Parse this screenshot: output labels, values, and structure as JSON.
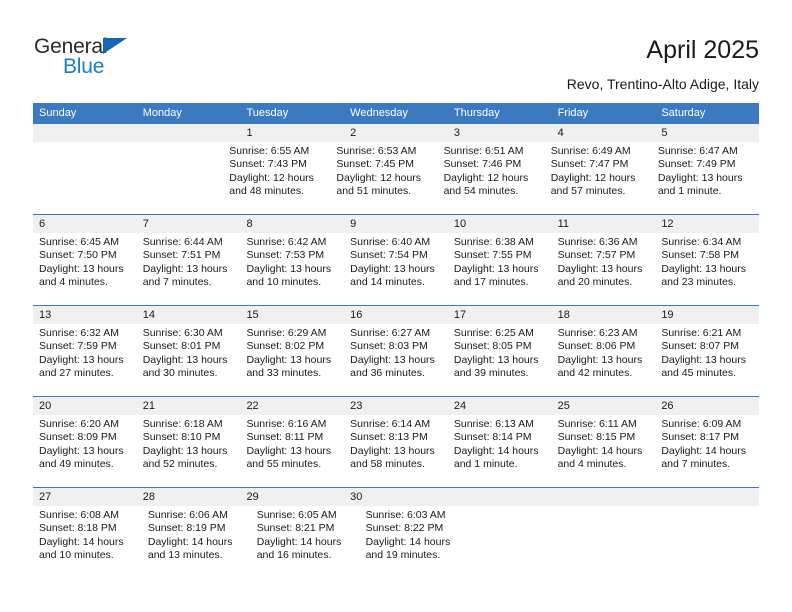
{
  "brand": {
    "name_top": "General",
    "name_bottom": "Blue",
    "triangle_icon": "triangle-icon",
    "color_dark": "#2b2b2b",
    "color_blue": "#1a7fd4"
  },
  "header": {
    "title": "April 2025",
    "subtitle": "Revo, Trentino-Alto Adige, Italy"
  },
  "theme": {
    "header_blue": "#3b7ac0",
    "daynum_gray": "#f0f0f0",
    "text": "#1a1a1a"
  },
  "calendar": {
    "weekdays": [
      "Sunday",
      "Monday",
      "Tuesday",
      "Wednesday",
      "Thursday",
      "Friday",
      "Saturday"
    ],
    "weeks": [
      {
        "days": [
          {
            "num": "",
            "lines": []
          },
          {
            "num": "",
            "lines": []
          },
          {
            "num": "1",
            "lines": [
              "Sunrise: 6:55 AM",
              "Sunset: 7:43 PM",
              "Daylight: 12 hours",
              "and 48 minutes."
            ]
          },
          {
            "num": "2",
            "lines": [
              "Sunrise: 6:53 AM",
              "Sunset: 7:45 PM",
              "Daylight: 12 hours",
              "and 51 minutes."
            ]
          },
          {
            "num": "3",
            "lines": [
              "Sunrise: 6:51 AM",
              "Sunset: 7:46 PM",
              "Daylight: 12 hours",
              "and 54 minutes."
            ]
          },
          {
            "num": "4",
            "lines": [
              "Sunrise: 6:49 AM",
              "Sunset: 7:47 PM",
              "Daylight: 12 hours",
              "and 57 minutes."
            ]
          },
          {
            "num": "5",
            "lines": [
              "Sunrise: 6:47 AM",
              "Sunset: 7:49 PM",
              "Daylight: 13 hours",
              "and 1 minute."
            ]
          }
        ]
      },
      {
        "days": [
          {
            "num": "6",
            "lines": [
              "Sunrise: 6:45 AM",
              "Sunset: 7:50 PM",
              "Daylight: 13 hours",
              "and 4 minutes."
            ]
          },
          {
            "num": "7",
            "lines": [
              "Sunrise: 6:44 AM",
              "Sunset: 7:51 PM",
              "Daylight: 13 hours",
              "and 7 minutes."
            ]
          },
          {
            "num": "8",
            "lines": [
              "Sunrise: 6:42 AM",
              "Sunset: 7:53 PM",
              "Daylight: 13 hours",
              "and 10 minutes."
            ]
          },
          {
            "num": "9",
            "lines": [
              "Sunrise: 6:40 AM",
              "Sunset: 7:54 PM",
              "Daylight: 13 hours",
              "and 14 minutes."
            ]
          },
          {
            "num": "10",
            "lines": [
              "Sunrise: 6:38 AM",
              "Sunset: 7:55 PM",
              "Daylight: 13 hours",
              "and 17 minutes."
            ]
          },
          {
            "num": "11",
            "lines": [
              "Sunrise: 6:36 AM",
              "Sunset: 7:57 PM",
              "Daylight: 13 hours",
              "and 20 minutes."
            ]
          },
          {
            "num": "12",
            "lines": [
              "Sunrise: 6:34 AM",
              "Sunset: 7:58 PM",
              "Daylight: 13 hours",
              "and 23 minutes."
            ]
          }
        ]
      },
      {
        "days": [
          {
            "num": "13",
            "lines": [
              "Sunrise: 6:32 AM",
              "Sunset: 7:59 PM",
              "Daylight: 13 hours",
              "and 27 minutes."
            ]
          },
          {
            "num": "14",
            "lines": [
              "Sunrise: 6:30 AM",
              "Sunset: 8:01 PM",
              "Daylight: 13 hours",
              "and 30 minutes."
            ]
          },
          {
            "num": "15",
            "lines": [
              "Sunrise: 6:29 AM",
              "Sunset: 8:02 PM",
              "Daylight: 13 hours",
              "and 33 minutes."
            ]
          },
          {
            "num": "16",
            "lines": [
              "Sunrise: 6:27 AM",
              "Sunset: 8:03 PM",
              "Daylight: 13 hours",
              "and 36 minutes."
            ]
          },
          {
            "num": "17",
            "lines": [
              "Sunrise: 6:25 AM",
              "Sunset: 8:05 PM",
              "Daylight: 13 hours",
              "and 39 minutes."
            ]
          },
          {
            "num": "18",
            "lines": [
              "Sunrise: 6:23 AM",
              "Sunset: 8:06 PM",
              "Daylight: 13 hours",
              "and 42 minutes."
            ]
          },
          {
            "num": "19",
            "lines": [
              "Sunrise: 6:21 AM",
              "Sunset: 8:07 PM",
              "Daylight: 13 hours",
              "and 45 minutes."
            ]
          }
        ]
      },
      {
        "days": [
          {
            "num": "20",
            "lines": [
              "Sunrise: 6:20 AM",
              "Sunset: 8:09 PM",
              "Daylight: 13 hours",
              "and 49 minutes."
            ]
          },
          {
            "num": "21",
            "lines": [
              "Sunrise: 6:18 AM",
              "Sunset: 8:10 PM",
              "Daylight: 13 hours",
              "and 52 minutes."
            ]
          },
          {
            "num": "22",
            "lines": [
              "Sunrise: 6:16 AM",
              "Sunset: 8:11 PM",
              "Daylight: 13 hours",
              "and 55 minutes."
            ]
          },
          {
            "num": "23",
            "lines": [
              "Sunrise: 6:14 AM",
              "Sunset: 8:13 PM",
              "Daylight: 13 hours",
              "and 58 minutes."
            ]
          },
          {
            "num": "24",
            "lines": [
              "Sunrise: 6:13 AM",
              "Sunset: 8:14 PM",
              "Daylight: 14 hours",
              "and 1 minute."
            ]
          },
          {
            "num": "25",
            "lines": [
              "Sunrise: 6:11 AM",
              "Sunset: 8:15 PM",
              "Daylight: 14 hours",
              "and 4 minutes."
            ]
          },
          {
            "num": "26",
            "lines": [
              "Sunrise: 6:09 AM",
              "Sunset: 8:17 PM",
              "Daylight: 14 hours",
              "and 7 minutes."
            ]
          }
        ]
      },
      {
        "days": [
          {
            "num": "27",
            "lines": [
              "Sunrise: 6:08 AM",
              "Sunset: 8:18 PM",
              "Daylight: 14 hours",
              "and 10 minutes."
            ]
          },
          {
            "num": "28",
            "lines": [
              "Sunrise: 6:06 AM",
              "Sunset: 8:19 PM",
              "Daylight: 14 hours",
              "and 13 minutes."
            ]
          },
          {
            "num": "29",
            "lines": [
              "Sunrise: 6:05 AM",
              "Sunset: 8:21 PM",
              "Daylight: 14 hours",
              "and 16 minutes."
            ]
          },
          {
            "num": "30",
            "lines": [
              "Sunrise: 6:03 AM",
              "Sunset: 8:22 PM",
              "Daylight: 14 hours",
              "and 19 minutes."
            ]
          },
          {
            "num": "",
            "lines": []
          },
          {
            "num": "",
            "lines": []
          },
          {
            "num": "",
            "lines": []
          }
        ]
      }
    ]
  }
}
